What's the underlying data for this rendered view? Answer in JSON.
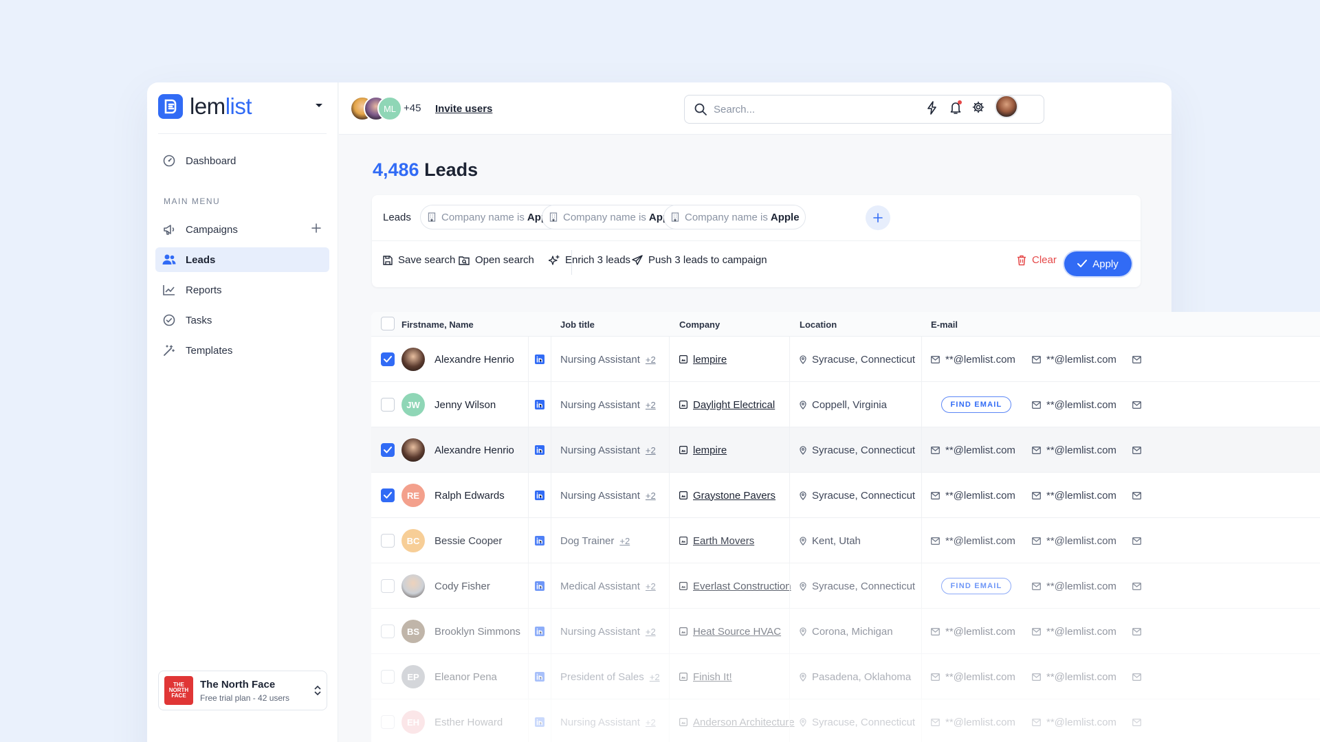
{
  "brand": {
    "name_part1": "lem",
    "name_part2": "list",
    "accent": "#316bf5"
  },
  "sidebar": {
    "dashboard": "Dashboard",
    "section_label": "MAIN MENU",
    "items": [
      {
        "label": "Campaigns",
        "icon": "megaphone-icon"
      },
      {
        "label": "Leads",
        "icon": "users-icon",
        "active": true
      },
      {
        "label": "Reports",
        "icon": "chart-line-icon"
      },
      {
        "label": "Tasks",
        "icon": "check-circle-icon"
      },
      {
        "label": "Templates",
        "icon": "magic-wand-icon"
      }
    ],
    "org": {
      "name": "The North Face",
      "plan": "Free trial plan - 42 users",
      "logo_text": "THE NORTH FACE"
    }
  },
  "header": {
    "avatar_initials": "ML",
    "extra_count": "+45",
    "invite_label": "Invite users",
    "search_placeholder": "Search..."
  },
  "page": {
    "count": "4,486",
    "title": "Leads"
  },
  "filters": {
    "label": "Leads",
    "chips": [
      {
        "field": "Company name is",
        "value": "Apple"
      },
      {
        "field": "Company name is",
        "value": "Apple"
      },
      {
        "field": "Company name is",
        "value": "Apple"
      }
    ]
  },
  "actions": {
    "save": "Save search",
    "open": "Open search",
    "enrich": "Enrich 3 leads",
    "push": "Push 3 leads to campaign",
    "clear": "Clear",
    "apply": "Apply"
  },
  "table": {
    "columns": {
      "name": "Firstname, Name",
      "job": "Job title",
      "company": "Company",
      "location": "Location",
      "email": "E-mail"
    },
    "find_email_label": "FIND EMAIL",
    "rows": [
      {
        "checked": true,
        "initials": "",
        "avatar_color": "#5a3a2e",
        "photo": true,
        "name": "Alexandre Henrio",
        "job": "Nursing Assistant",
        "extra": "+2",
        "company": "lempire",
        "location": "Syracuse, Connecticut",
        "email1": "**@lemlist.com",
        "email2": "**@lemlist.com",
        "opacity": 1
      },
      {
        "checked": false,
        "initials": "JW",
        "avatar_color": "#8fd6b6",
        "photo": false,
        "name": "Jenny Wilson",
        "job": "Nursing Assistant",
        "extra": "+2",
        "company": "Daylight Electrical",
        "location": "Coppell, Virginia",
        "email1": "",
        "email2": "**@lemlist.com",
        "find_email": true,
        "opacity": 1
      },
      {
        "checked": true,
        "initials": "",
        "avatar_color": "#5a3a2e",
        "photo": true,
        "name": "Alexandre Henrio",
        "job": "Nursing Assistant",
        "extra": "+2",
        "company": "lempire",
        "location": "Syracuse, Connecticut",
        "email1": "**@lemlist.com",
        "email2": "**@lemlist.com",
        "highlight": true,
        "opacity": 1
      },
      {
        "checked": true,
        "initials": "RE",
        "avatar_color": "#f3a08c",
        "photo": false,
        "name": "Ralph Edwards",
        "job": "Nursing Assistant",
        "extra": "+2",
        "company": "Graystone Pavers",
        "location": "Syracuse, Connecticut",
        "email1": "**@lemlist.com",
        "email2": "**@lemlist.com",
        "opacity": 1
      },
      {
        "checked": false,
        "initials": "BC",
        "avatar_color": "#f6c686",
        "photo": false,
        "name": "Bessie Cooper",
        "job": "Dog Trainer",
        "extra": "+2",
        "company": "Earth Movers",
        "location": "Kent, Utah",
        "email1": "**@lemlist.com",
        "email2": "**@lemlist.com",
        "opacity": 0.85
      },
      {
        "checked": false,
        "initials": "",
        "avatar_color": "#b8bec6",
        "photo": true,
        "name": "Cody Fisher",
        "job": "Medical Assistant",
        "extra": "+2",
        "company": "Everlast Construction",
        "location": "Syracuse, Connecticut",
        "email1": "",
        "email2": "**@lemlist.com",
        "find_email": true,
        "opacity": 0.7
      },
      {
        "checked": false,
        "initials": "BS",
        "avatar_color": "#8d7a63",
        "photo": false,
        "name": "Brooklyn Simmons",
        "job": "Nursing Assistant",
        "extra": "+2",
        "company": "Heat Source HVAC",
        "location": "Corona, Michigan",
        "email1": "**@lemlist.com",
        "email2": "**@lemlist.com",
        "opacity": 0.55
      },
      {
        "checked": false,
        "initials": "EP",
        "avatar_color": "#9aa0a8",
        "photo": false,
        "name": "Eleanor Pena",
        "job": "President of Sales",
        "extra": "+2",
        "company": "Finish It!",
        "location": "Pasadena, Oklahoma",
        "email1": "**@lemlist.com",
        "email2": "**@lemlist.com",
        "opacity": 0.42
      },
      {
        "checked": false,
        "initials": "EH",
        "avatar_color": "#f2a0a8",
        "photo": false,
        "name": "Esther Howard",
        "job": "Nursing Assistant",
        "extra": "+2",
        "company": "Anderson Architecture",
        "location": "Syracuse, Connecticut",
        "email1": "**@lemlist.com",
        "email2": "**@lemlist.com",
        "opacity": 0.25
      }
    ]
  }
}
